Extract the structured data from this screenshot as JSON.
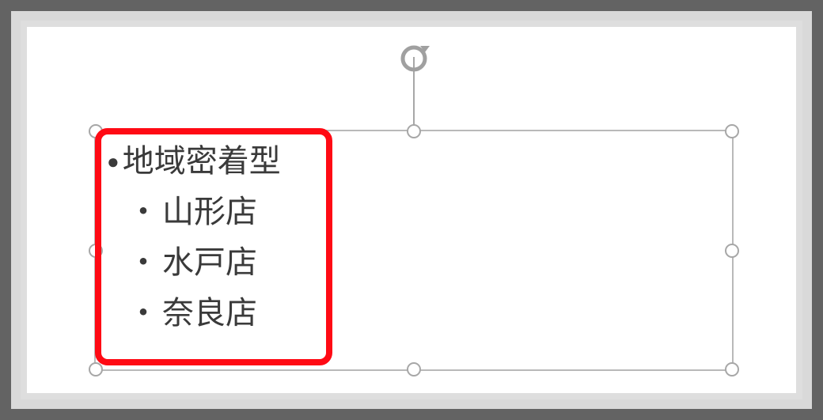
{
  "textbox": {
    "bullets": {
      "level1": {
        "marker": "●",
        "text": "地域密着型"
      },
      "level2": {
        "marker": "・",
        "items": [
          "山形店",
          "水戸店",
          "奈良店"
        ]
      }
    }
  }
}
